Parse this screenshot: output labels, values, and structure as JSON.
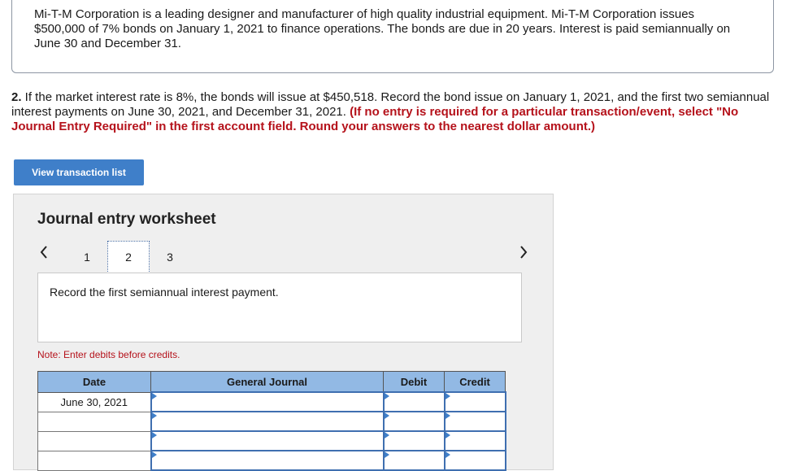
{
  "intro": {
    "text": "Mi-T-M Corporation is a leading designer and manufacturer of high quality industrial equipment.  Mi-T-M Corporation issues $500,000 of 7% bonds on January 1, 2021 to finance operations.  The bonds are due in 20 years. Interest is paid semiannually on June 30 and December 31."
  },
  "question": {
    "number": "2.",
    "text": " If the market interest rate is 8%, the bonds will issue at $450,518. Record the bond issue on January 1, 2021, and the first two semiannual interest payments on June 30, 2021, and December 31, 2021. ",
    "instruction": "(If no entry is required for a particular transaction/event, select \"No Journal Entry Required\" in the first account field. Round your answers to the nearest dollar amount.)"
  },
  "view_button": {
    "label": "View transaction list"
  },
  "worksheet": {
    "title": "Journal entry worksheet",
    "pages": [
      "1",
      "2",
      "3"
    ],
    "active_page": "2",
    "instruction": "Record the first semiannual interest payment.",
    "note": "Note: Enter debits before credits.",
    "columns": [
      "Date",
      "General Journal",
      "Debit",
      "Credit"
    ],
    "rows": [
      {
        "date": "June 30, 2021",
        "account": "",
        "debit": "",
        "credit": ""
      },
      {
        "date": "",
        "account": "",
        "debit": "",
        "credit": ""
      },
      {
        "date": "",
        "account": "",
        "debit": "",
        "credit": ""
      },
      {
        "date": "",
        "account": "",
        "debit": "",
        "credit": ""
      }
    ]
  },
  "colors": {
    "button": "#3f7fc9",
    "table_header": "#92b9e4",
    "emphasis_red": "#b5121b"
  }
}
